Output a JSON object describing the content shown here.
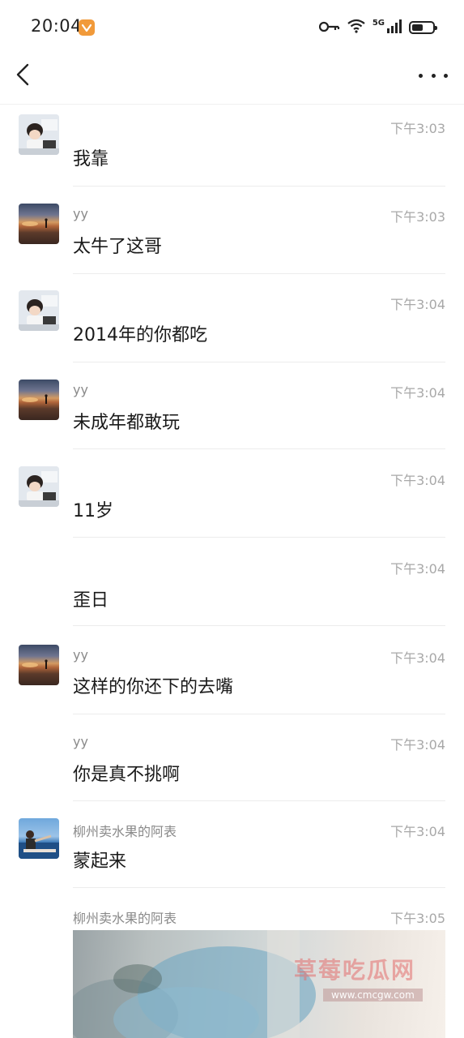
{
  "status_bar": {
    "time": "20:04",
    "network": "5G",
    "battery_level": 0.55
  },
  "nav": {
    "back_icon": "chevron-left-icon",
    "more_icon": "more-horizontal-icon"
  },
  "messages": [
    {
      "sender": "",
      "time": "下午3:03",
      "text": "我靠",
      "avatar": "anime-avatar"
    },
    {
      "sender": "yy",
      "time": "下午3:03",
      "text": "太牛了这哥",
      "avatar": "sunset-avatar"
    },
    {
      "sender": "",
      "time": "下午3:04",
      "text": "2014年的你都吃",
      "avatar": "anime-avatar"
    },
    {
      "sender": "yy",
      "time": "下午3:04",
      "text": "未成年都敢玩",
      "avatar": "sunset-avatar"
    },
    {
      "sender": "",
      "time": "下午3:04",
      "text": "11岁",
      "avatar": "anime-avatar"
    },
    {
      "sender": "",
      "time": "下午3:04",
      "text": "歪日",
      "avatar": ""
    },
    {
      "sender": "yy",
      "time": "下午3:04",
      "text": "这样的你还下的去嘴",
      "avatar": "sunset-avatar"
    },
    {
      "sender": "yy",
      "time": "下午3:04",
      "text": "你是真不挑啊",
      "avatar": ""
    },
    {
      "sender": "柳州卖水果的阿表",
      "time": "下午3:04",
      "text": "蒙起来",
      "avatar": "sea-avatar"
    },
    {
      "sender": "柳州卖水果的阿表",
      "time": "下午3:05",
      "text": "",
      "avatar": ""
    }
  ],
  "watermark": {
    "title": "草莓吃瓜网",
    "url": "www.cmcgw.com"
  }
}
